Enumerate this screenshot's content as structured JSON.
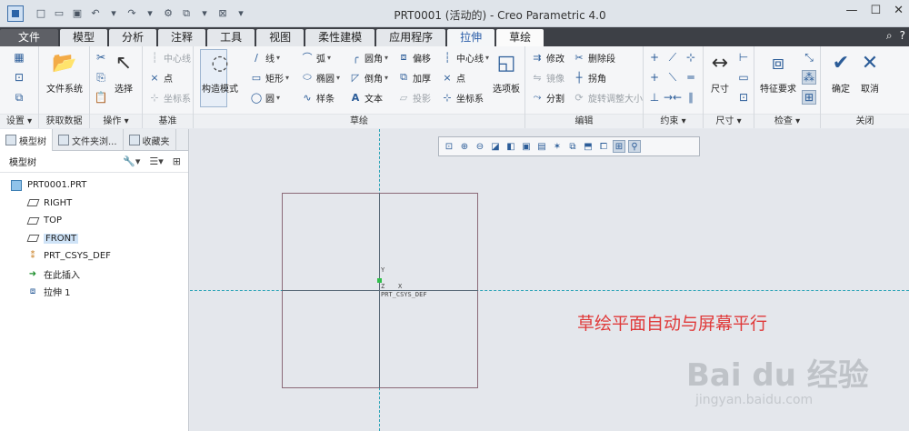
{
  "titlebar": {
    "title": "PRT0001 (活动的) - Creo Parametric 4.0",
    "quick_access": [
      "new-icon",
      "open-icon",
      "save-icon",
      "undo-icon",
      "redo-icon",
      "regenerate-icon",
      "switch-window-icon",
      "close-icon"
    ]
  },
  "tabs": [
    "文件",
    "模型",
    "分析",
    "注释",
    "工具",
    "视图",
    "柔性建模",
    "应用程序",
    "拉伸",
    "草绘"
  ],
  "ribbon": {
    "groups": {
      "setup": "设置",
      "get_data": "获取数据",
      "operations": "操作",
      "datum": "基准",
      "sketch": "草绘",
      "edit": "编辑",
      "constrain": "约束",
      "dimension": "尺寸",
      "inspect": "检查",
      "close": "关闭"
    },
    "file_system": "文件系统",
    "select": "选择",
    "datum_items": [
      "中心线",
      "点",
      "坐标系"
    ],
    "construction_mode": "构造模式",
    "sketch_col1": [
      "线",
      "矩形",
      "圆"
    ],
    "sketch_col2": [
      "弧",
      "椭圆",
      "样条"
    ],
    "sketch_col3": [
      "圆角",
      "倒角",
      "文本"
    ],
    "sketch_col4": [
      "偏移",
      "加厚",
      "投影"
    ],
    "sketch_col5": [
      "中心线",
      "点",
      "坐标系"
    ],
    "palette": "选项板",
    "edit_items": [
      "修改",
      "删除段",
      "镜像",
      "拐角",
      "分割",
      "旋转调整大小"
    ],
    "dimension_btn": "尺寸",
    "feature_req": "特征要求",
    "ok": "确定",
    "cancel": "取消"
  },
  "panel": {
    "tabs": [
      "模型树",
      "文件夹浏...",
      "收藏夹"
    ],
    "toolbar_label": "模型树",
    "tree": [
      {
        "label": "PRT0001.PRT",
        "icon": "part-icon"
      },
      {
        "label": "RIGHT",
        "icon": "datum-plane-icon"
      },
      {
        "label": "TOP",
        "icon": "datum-plane-icon"
      },
      {
        "label": "FRONT",
        "icon": "datum-plane-icon"
      },
      {
        "label": "PRT_CSYS_DEF",
        "icon": "csys-icon"
      },
      {
        "label": "在此插入",
        "icon": "insert-here-icon"
      },
      {
        "label": "拉伸 1",
        "icon": "extrude-icon"
      }
    ]
  },
  "graphics": {
    "csys_label": "PRT_CSYS_DEF",
    "axis_y": "Y",
    "axis_x": "X",
    "axis_z": "Z",
    "annotation": "草绘平面自动与屏幕平行",
    "watermark": "Bai du 经验",
    "watermark_url": "jingyan.baidu.com"
  },
  "colors": {
    "annotation": "#e03a3a",
    "tabbar": "#3d4046",
    "context_tab": "#2a5da8",
    "reference_line": "#2ea5b8"
  }
}
